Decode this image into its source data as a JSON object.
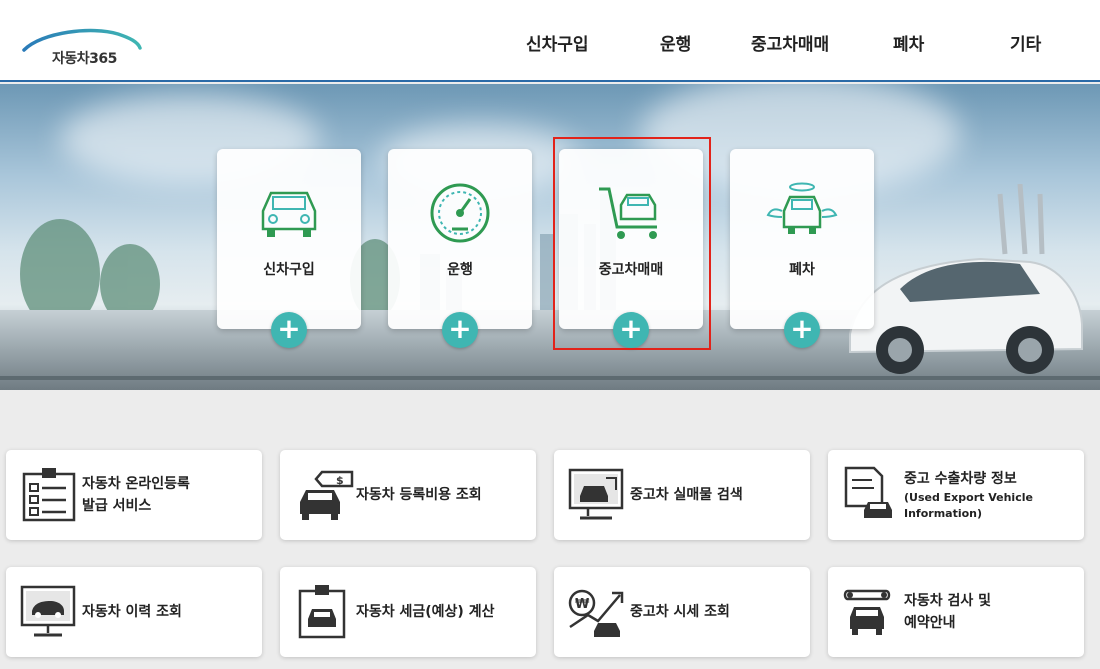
{
  "header": {
    "logo_text": "자동차365",
    "nav": [
      "신차구입",
      "운행",
      "중고차매매",
      "폐차",
      "기타"
    ]
  },
  "hero": {
    "cards": [
      {
        "label": "신차구입",
        "icon": "car-icon"
      },
      {
        "label": "운행",
        "icon": "speedometer-icon"
      },
      {
        "label": "중고차매매",
        "icon": "cart-car-icon"
      },
      {
        "label": "폐차",
        "icon": "angel-car-icon"
      }
    ],
    "plus_symbol": "+"
  },
  "services": [
    {
      "line1": "자동차 온라인등록",
      "line2": "발급 서비스",
      "icon": "clipboard-checklist-icon"
    },
    {
      "line1": "자동차 등록비용 조회",
      "line2": "",
      "icon": "car-price-tag-icon"
    },
    {
      "line1": "중고차 실매물 검색",
      "line2": "",
      "icon": "monitor-car-icon"
    },
    {
      "line1": "중고 수출차량 정보",
      "line2": "(Used Export Vehicle Information)",
      "icon": "document-car-icon"
    },
    {
      "line1": "자동차 이력 조회",
      "line2": "",
      "icon": "monitor-history-icon"
    },
    {
      "line1": "자동차 세금(예상) 계산",
      "line2": "",
      "icon": "tax-car-icon"
    },
    {
      "line1": "중고차 시세 조회",
      "line2": "",
      "icon": "won-trend-car-icon"
    },
    {
      "line1": "자동차 검사 및",
      "line2": "예약안내",
      "icon": "wrench-car-icon"
    }
  ],
  "colors": {
    "accent": "#3fb6b2",
    "header_line": "#2a6aa7",
    "highlight": "#e2231a",
    "icon_green": "#2f9a52"
  }
}
